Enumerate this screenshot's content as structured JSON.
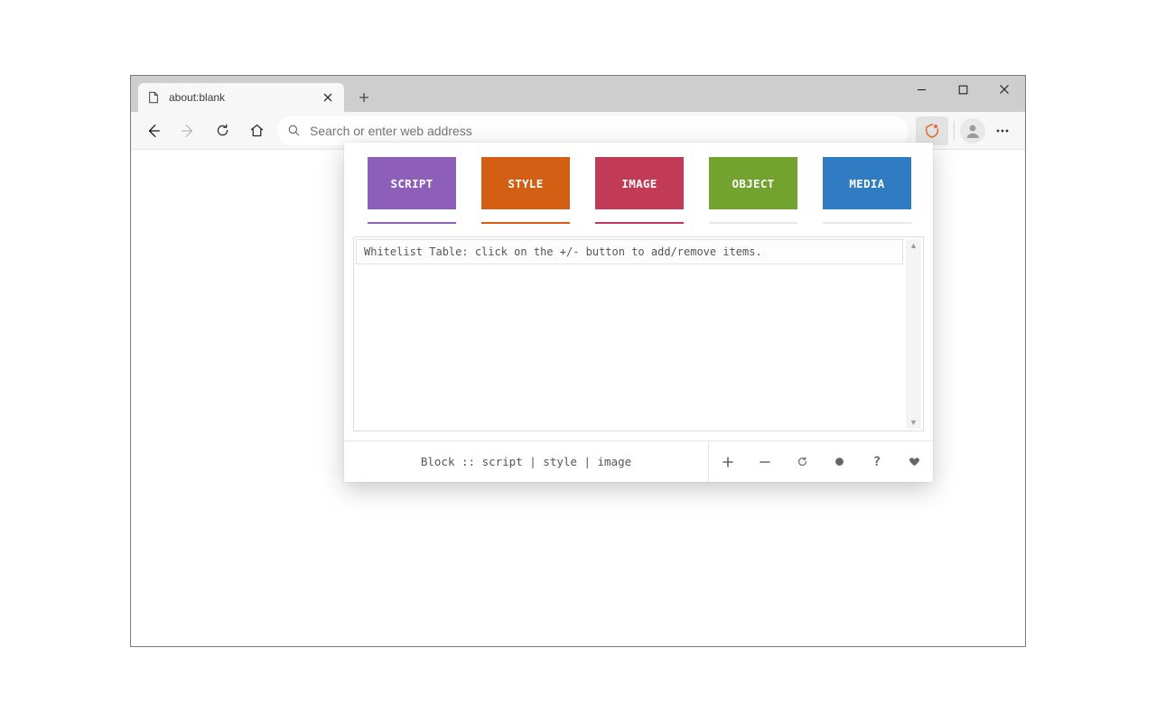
{
  "browser": {
    "tab_title": "about:blank",
    "address_placeholder": "Search or enter web address"
  },
  "popup": {
    "tabs": [
      {
        "key": "script",
        "label": "SCRIPT",
        "active": true
      },
      {
        "key": "style",
        "label": "STYLE",
        "active": true
      },
      {
        "key": "image",
        "label": "IMAGE",
        "active": true
      },
      {
        "key": "object",
        "label": "OBJECT",
        "active": false
      },
      {
        "key": "media",
        "label": "MEDIA",
        "active": false
      }
    ],
    "whitelist_info": "Whitelist Table: click on the +/- button to add/remove items.",
    "footer_status": "Block :: script | style | image"
  },
  "colors": {
    "script": "#8e5fb9",
    "style": "#d35f15",
    "image": "#c13a56",
    "object": "#72a32e",
    "media": "#2f7cc2"
  }
}
